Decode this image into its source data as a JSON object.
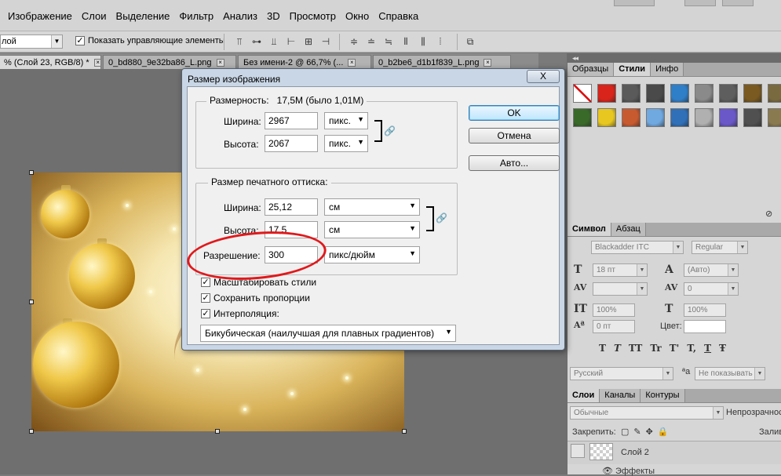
{
  "menu": [
    "Изображение",
    "Слои",
    "Выделение",
    "Фильтр",
    "Анализ",
    "3D",
    "Просмотр",
    "Окно",
    "Справка"
  ],
  "options": {
    "mode_value": "лой",
    "show_controls_label": "Показать управляющие элементы",
    "show_controls_checked": true
  },
  "tabs": [
    {
      "label": "% (Слой 23, RGB/8) *",
      "active": true
    },
    {
      "label": "0_bd880_9e32ba86_L.png",
      "active": false
    },
    {
      "label": "Без имени-2 @ 66,7% (...",
      "active": false
    },
    {
      "label": "0_b2be6_d1b1f839_L.png",
      "active": false
    }
  ],
  "dialog": {
    "title": "Размер изображения",
    "close": "X",
    "pixel_dims": {
      "legend": "Размерность:",
      "size": "17,5M (было 1,01M)",
      "width_label": "Ширина:",
      "width_value": "2967",
      "width_unit": "пикс.",
      "height_label": "Высота:",
      "height_value": "2067",
      "height_unit": "пикс."
    },
    "doc_size": {
      "legend": "Размер печатного оттиска:",
      "width_label": "Ширина:",
      "width_value": "25,12",
      "width_unit": "см",
      "height_label": "Высота:",
      "height_value": "17,5",
      "height_unit": "см",
      "res_label": "Разрешение:",
      "res_value": "300",
      "res_unit": "пикс/дюйм"
    },
    "scale_styles": "Масштабировать стили",
    "constrain": "Сохранить пропорции",
    "resample": "Интерполяция:",
    "resample_method": "Бикубическая (наилучшая для плавных градиентов)",
    "ok": "OK",
    "cancel": "Отмена",
    "auto": "Авто..."
  },
  "panel_styles": {
    "tabs": [
      "Образцы",
      "Стили",
      "Инфо"
    ],
    "active_tab": "Стили",
    "swatch_colors": [
      "#ffffff",
      "#d8241a",
      "#5a5a5a",
      "#4a4a4a",
      "#2f7fc8",
      "#8a8a8a",
      "#5e5e5e",
      "#7a5a20",
      "#7a6a40",
      "#6a6a6a",
      "#3a6a2a",
      "#e8c820",
      "#c85a30",
      "#70a8e0",
      "#3070b8",
      "#b0b0b0",
      "#6a58c8",
      "#505050",
      "#8a7a50",
      "#5a5a5a"
    ]
  },
  "panel_char": {
    "tabs": [
      "Символ",
      "Абзац"
    ],
    "font": "Blackadder ITC",
    "style": "Regular",
    "size": "18 пт",
    "leading": "(Авто)",
    "tracking": "0",
    "vscale": "100%",
    "hscale": "100%",
    "baseline": "0 пт",
    "color_label": "Цвет:",
    "type_buttons": [
      "T",
      "T",
      "TT",
      "Tr",
      "T'",
      "T,",
      "T",
      "Ŧ"
    ],
    "language": "Русский",
    "aa_label": "a",
    "antialias": "Не показывать"
  },
  "panel_layers": {
    "tabs": [
      "Слои",
      "Каналы",
      "Контуры"
    ],
    "blend": "Обычные",
    "opacity_label": "Непрозрачност",
    "lock_label": "Закрепить:",
    "fill_label": "Залив",
    "layer_name": "Слой 2",
    "effects": "Эффекты"
  }
}
